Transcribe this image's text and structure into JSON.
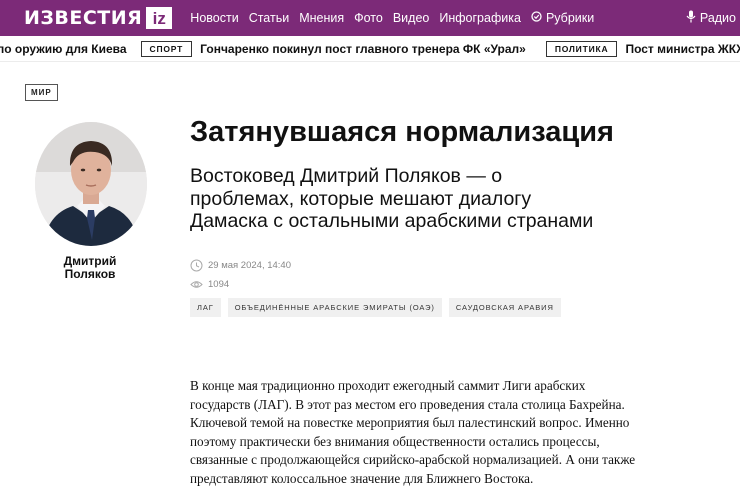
{
  "header": {
    "logo_text": "ИЗВЕСТИЯ",
    "logo_badge": "iz",
    "nav": [
      "Новости",
      "Статьи",
      "Мнения",
      "Фото",
      "Видео",
      "Инфографика"
    ],
    "rubrics_label": "Рубрики",
    "radio_label": "Радио",
    "brand_color": "#7c2a78"
  },
  "ticker": {
    "item1_text": "по оружию для Киева",
    "item2_tag": "СПОРТ",
    "item2_text": "Гончаренко покинул пост главного тренера ФК «Урал»",
    "item3_tag": "ПОЛИТИКА",
    "item3_text": "Пост министра ЖКХ Крым"
  },
  "article": {
    "section": "МИР",
    "author_first": "Дмитрий",
    "author_last": "Поляков",
    "title": "Затянувшаяся нормализация",
    "subtitle": "Востоковед Дмитрий Поляков — о проблемах, которые мешают диалогу Дамаска с остальными арабскими странами",
    "date": "29 мая 2024, 14:40",
    "views": "1094",
    "tags": [
      "ЛАГ",
      "ОБЪЕДИНЁННЫЕ АРАБСКИЕ ЭМИРАТЫ (ОАЭ)",
      "САУДОВСКАЯ АРАВИЯ"
    ],
    "body_lines": [
      "В конце мая традиционно проходит ежегодный саммит Лиги арабских",
      "государств (ЛАГ). В этот раз местом его проведения стала столица Бахрейна.",
      "Ключевой темой на повестке мероприятия был палестинский вопрос. Именно",
      "поэтому практически без внимания общественности остались процессы,",
      "связанные с продолжающейся сирийско-арабской нормализацией. А они также",
      "представляют колоссальное значение для Ближнего Востока."
    ]
  }
}
